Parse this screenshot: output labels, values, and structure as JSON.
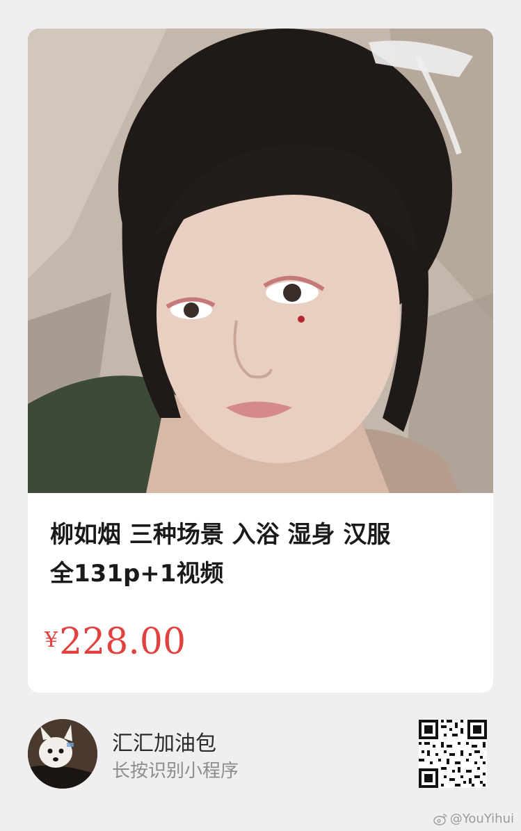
{
  "product": {
    "image_alt": "product-photo",
    "title_line1": "柳如烟 三种场景 入浴 湿身 汉服",
    "title_line2": "全131p+1视频",
    "currency": "¥",
    "price": "228.00",
    "price_color": "#e2423f"
  },
  "mini_program": {
    "name": "汇汇加油包",
    "hint": "长按识别小程序"
  },
  "watermark": {
    "icon": "weibo-icon",
    "handle": "@YouYihui"
  },
  "colors": {
    "background": "#efeff2",
    "card": "#ffffff",
    "title_text": "#1a1a1a",
    "hint_text": "#8d8d8d"
  }
}
